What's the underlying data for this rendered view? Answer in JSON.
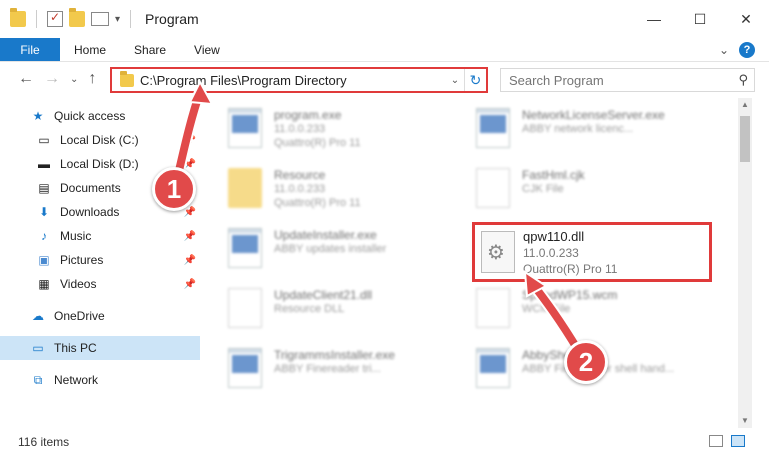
{
  "window": {
    "title": "Program",
    "minimize": "—",
    "maximize": "☐",
    "close": "✕"
  },
  "ribbon": {
    "file": "File",
    "tabs": [
      "Home",
      "Share",
      "View"
    ],
    "expand": "⌄",
    "help": "?"
  },
  "nav": {
    "back": "←",
    "forward": "→",
    "recent": "⌄",
    "up": "↑"
  },
  "address": {
    "path": "C:\\Program Files\\Program Directory",
    "dropdown": "⌄",
    "refresh": "↻"
  },
  "search": {
    "placeholder": "Search Program",
    "icon": "⚲"
  },
  "sidebar": {
    "items": [
      {
        "label": "Quick access",
        "icon": "★",
        "pinned": false
      },
      {
        "label": "Local Disk (C:)",
        "icon": "▭",
        "pinned": true
      },
      {
        "label": "Local Disk (D:)",
        "icon": "▬",
        "pinned": true
      },
      {
        "label": "Documents",
        "icon": "▤",
        "pinned": true
      },
      {
        "label": "Downloads",
        "icon": "⬇",
        "pinned": true
      },
      {
        "label": "Music",
        "icon": "♪",
        "pinned": true
      },
      {
        "label": "Pictures",
        "icon": "▣",
        "pinned": true
      },
      {
        "label": "Videos",
        "icon": "▦",
        "pinned": true
      },
      {
        "label": "OneDrive",
        "icon": "☁",
        "pinned": false
      },
      {
        "label": "This PC",
        "icon": "▭",
        "pinned": false
      },
      {
        "label": "Network",
        "icon": "⧉",
        "pinned": false
      }
    ],
    "pin_glyph": "📌"
  },
  "files": [
    {
      "name": "program.exe",
      "line1": "11.0.0.233",
      "line2": "Quattro(R) Pro 11",
      "type": "exe"
    },
    {
      "name": "NetworkLicenseServer.exe",
      "line1": "ABBY network licenc...",
      "line2": "",
      "type": "exe"
    },
    {
      "name": "Resource",
      "line1": "11.0.0.233",
      "line2": "Quattro(R) Pro 11",
      "type": "folder"
    },
    {
      "name": "FastHml.cjk",
      "line1": "CJK File",
      "line2": "",
      "type": "doc"
    },
    {
      "name": "UpdateInstaller.exe",
      "line1": "ABBY updates installer",
      "line2": "",
      "type": "exe"
    },
    {
      "name": "UpdateClient21.dll",
      "line1": "Resource DLL",
      "line2": "",
      "type": "doc"
    },
    {
      "name": "SpeedWP15.wcm",
      "line1": "WCM File",
      "line2": "",
      "type": "doc"
    },
    {
      "name": "TrigrammsInstaller.exe",
      "line1": "ABBY Finereader tri...",
      "line2": "",
      "type": "exe"
    },
    {
      "name": "AbbyShell.exe",
      "line1": "ABBY FineReader shell hand...",
      "line2": "",
      "type": "exe"
    }
  ],
  "highlighted_file": {
    "name": "qpw110.dll",
    "line1": "11.0.0.233",
    "line2": "Quattro(R) Pro 11"
  },
  "annotations": {
    "step1": "1",
    "step2": "2"
  },
  "status": {
    "item_count": "116 items"
  },
  "colors": {
    "accent": "#1979ca",
    "annotation_red": "#e03a3a"
  }
}
